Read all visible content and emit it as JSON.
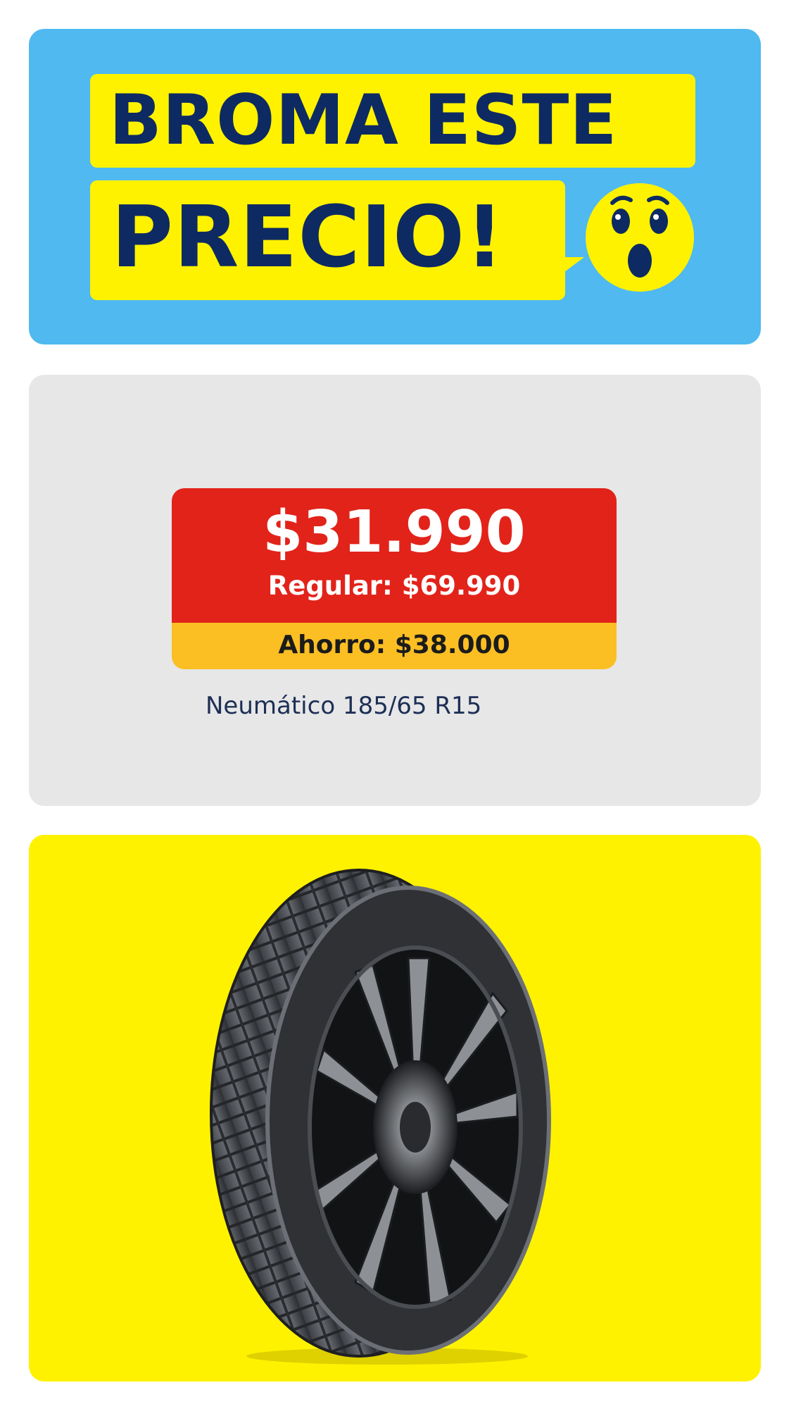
{
  "colors": {
    "banner_bg": "#4fb9f0",
    "headline_highlight": "#fff200",
    "headline_text": "#0e2a63",
    "price_card_bg": "#e7e7e8",
    "price_red": "#e2231a",
    "price_yellow": "#fbbf24",
    "image_card_bg": "#fff200"
  },
  "banner": {
    "headline_line1": "BROMA ESTE",
    "headline_line2": "PRECIO!",
    "emoji_icon": "surprised-face-icon"
  },
  "price": {
    "current": "$31.990",
    "regular": "Regular: $69.990",
    "saving": "Ahorro: $38.000"
  },
  "product": {
    "name": "Neumático 185/65 R15",
    "image_icon": "tire-icon"
  }
}
